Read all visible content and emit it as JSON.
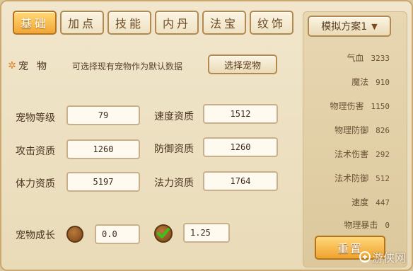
{
  "tabs": [
    {
      "label": "基础",
      "active": true
    },
    {
      "label": "加点",
      "active": false
    },
    {
      "label": "技能",
      "active": false
    },
    {
      "label": "内丹",
      "active": false
    },
    {
      "label": "法宝",
      "active": false
    },
    {
      "label": "纹饰",
      "active": false
    }
  ],
  "pet": {
    "label": "宠物",
    "description": "可选择现有宠物作为默认数据",
    "select_button": "选择宠物"
  },
  "fields": {
    "pet_level": {
      "label": "宠物等级",
      "value": "79"
    },
    "speed_quality": {
      "label": "速度资质",
      "value": "1512"
    },
    "attack_quality": {
      "label": "攻击资质",
      "value": "1260"
    },
    "defense_quality": {
      "label": "防御资质",
      "value": "1260"
    },
    "hp_quality": {
      "label": "体力资质",
      "value": "5197"
    },
    "magic_quality": {
      "label": "法力资质",
      "value": "1764"
    }
  },
  "growth": {
    "label": "宠物成长",
    "option1_value": "0.0",
    "option2_value": "1.25",
    "option2_checked": true
  },
  "scheme": {
    "label": "模拟方案1"
  },
  "stats": [
    {
      "label": "气血",
      "value": "3233"
    },
    {
      "label": "魔法",
      "value": "910"
    },
    {
      "label": "物理伤害",
      "value": "1150"
    },
    {
      "label": "物理防御",
      "value": "826"
    },
    {
      "label": "法术伤害",
      "value": "292"
    },
    {
      "label": "法术防御",
      "value": "512"
    },
    {
      "label": "速度",
      "value": "447"
    },
    {
      "label": "物理暴击",
      "value": "0"
    }
  ],
  "reset_button": "重置",
  "watermark": "游侠网",
  "colors": {
    "tab_active": "#f3a634",
    "accent": "#e07f2a",
    "check": "#3ec21a"
  }
}
